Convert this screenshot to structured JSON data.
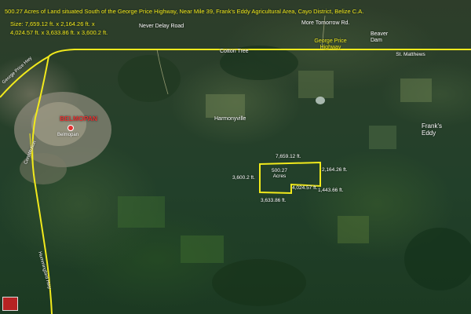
{
  "header": {
    "title": "500.27 Acres of Land situated South of the George Price Highway, Near Mile 39, Frank's Eddy Agricultural Area, Cayo District, Belize C.A.",
    "size_line_1": "Size:  7,659.12 ft. x 2,164.26 ft. x",
    "size_line_2": "4,024.57 ft. x 3,633.86 ft. x 3,600.2 ft."
  },
  "places": {
    "never_delay": "Never Delay Road",
    "more_tomorrow": "More Tomorrow Rd.",
    "beaver_dam": "Beaver Dam",
    "cotton_tree": "Cotton Tree",
    "st_matthews": "St. Matthews",
    "harmonyville": "Harmonyville",
    "franks_eddy": "Frank's Eddy",
    "belmopan_city": "BELMOPAN",
    "belmopan_small": "Belmopan"
  },
  "roads": {
    "george_price_hwy": "George Price Highway",
    "george_price_hwy_side": "George Price Hwy",
    "constitution": "Constitution",
    "hummingbird": "Hummingbird Hwy"
  },
  "parcel": {
    "area_label": "500.27 Acres",
    "sides": {
      "north": "7,659.12 ft.",
      "east": "2,164.26 ft.",
      "south_inner": "4,024.57 ft.",
      "west": "3,600.2 ft.",
      "south": "3,633.86 ft.",
      "southeast": "1,443.66 ft."
    }
  },
  "colors": {
    "road": "#f2ea1c",
    "boundary": "#f2ea1c",
    "city_label": "#e23131",
    "label": "#ffffff"
  },
  "icons": {
    "city_marker": "city-pin-icon",
    "badge": "logo-badge-icon"
  }
}
